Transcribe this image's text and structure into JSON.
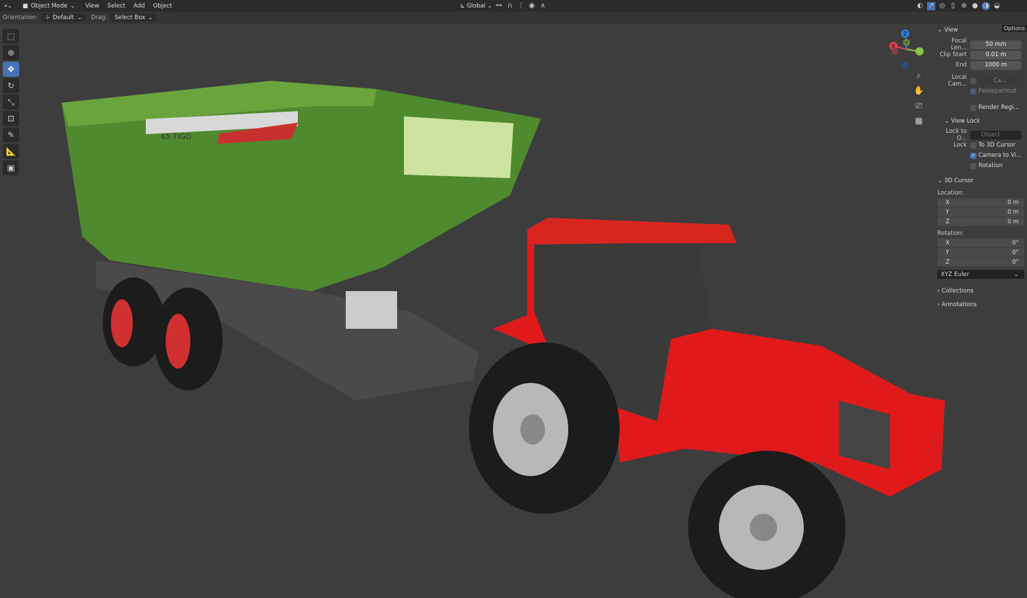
{
  "header": {
    "mode": "Object Mode",
    "menus": [
      "View",
      "Select",
      "Add",
      "Object"
    ],
    "transform_orientation": "Global"
  },
  "tool_header": {
    "orientation_label": "Orientation:",
    "orientation_value": "Default",
    "drag_label": "Drag:",
    "drag_value": "Select Box",
    "options": "Options"
  },
  "toolbar": [
    "select-box",
    "cursor",
    "move",
    "rotate",
    "scale",
    "transform",
    "annotate",
    "measure",
    "add-cube"
  ],
  "gizmo": {
    "x": "X",
    "y": "Y",
    "z": "Z"
  },
  "sidebar": {
    "view": {
      "title": "View",
      "focal_label": "Focal Len...",
      "focal": "50 mm",
      "clip_start_label": "Clip Start",
      "clip_start": "0.01 m",
      "end_label": "End",
      "end": "1000 m",
      "local_cam_label": "Local Cam...",
      "local_cam": "Ca...",
      "passepartout": "Passepartout",
      "render_region": "Render Regi..."
    },
    "view_lock": {
      "title": "View Lock",
      "lock_to_label": "Lock to O...",
      "lock_to_placeholder": "Object",
      "lock_label": "Lock",
      "to_cursor": "To 3D Cursor",
      "camera_to_view": "Camera to Vi...",
      "camera_to_view_checked": true,
      "rotation": "Rotation"
    },
    "cursor": {
      "title": "3D Cursor",
      "location_label": "Location:",
      "location": [
        {
          "axis": "X",
          "value": "0 m"
        },
        {
          "axis": "Y",
          "value": "0 m"
        },
        {
          "axis": "Z",
          "value": "0 m"
        }
      ],
      "rotation_label": "Rotation:",
      "rotation": [
        {
          "axis": "X",
          "value": "0°"
        },
        {
          "axis": "Y",
          "value": "0°"
        },
        {
          "axis": "Z",
          "value": "0°"
        }
      ],
      "mode": "XYZ Euler"
    },
    "collections": "Collections",
    "annotations": "Annotations"
  },
  "scene": {
    "trailer_decal": "65 TIGO",
    "colors": {
      "trailer": "#4f8a2e",
      "tractor": "#e01a1a",
      "tire": "#1c1c1c",
      "rim": "#b8b8b8"
    }
  }
}
